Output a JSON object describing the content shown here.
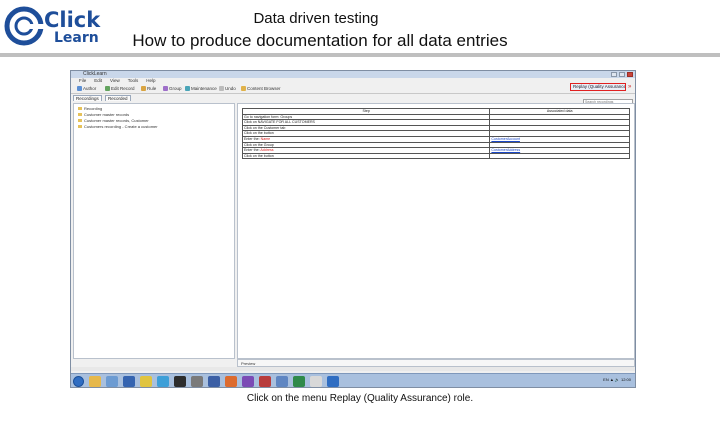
{
  "logo": {
    "line1": "Click",
    "line2": "Learn"
  },
  "slide": {
    "title": "Data driven testing",
    "subtitle": "How to produce documentation for all data entries",
    "caption": "Click on the menu Replay (Quality Assurance) role."
  },
  "app": {
    "window_title": "ClickLearn",
    "menu": [
      "File",
      "Edit",
      "View",
      "Tools",
      "Help"
    ],
    "toolbar": {
      "items": [
        {
          "label": "Author",
          "color": "#5b8fd4"
        },
        {
          "label": "Edit Record",
          "color": "#62a35e"
        },
        {
          "label": "Rule",
          "color": "#d9a441"
        },
        {
          "label": "Group",
          "color": "#9e6fc9"
        },
        {
          "label": "Maintenance",
          "color": "#4aa5b8"
        },
        {
          "label": "Undo",
          "color": "#bcbcbc"
        },
        {
          "label": "Content Browser",
          "color": "#e0b24a"
        }
      ],
      "role_button": "Replay (Quality Assurance) role",
      "role_extra": "»"
    },
    "tabs": [
      "Recordings",
      "Recorded"
    ],
    "search_placeholder": "Search recordings"
  },
  "tree": [
    "Recording",
    "Customer master records",
    "Customer master records, Customer",
    "Customers recording - Create a customer"
  ],
  "grid": {
    "headers": [
      "Step",
      "Associated data"
    ],
    "rows": [
      {
        "step": "Go to navigation form: Groups",
        "value": "",
        "red": false
      },
      {
        "step": "Click on NAVIGATE FOR ALL CUSTOMERS",
        "value": "",
        "red": false
      },
      {
        "step": "Click on the Customer tab",
        "value": "",
        "red": false
      },
      {
        "step": "Click on the button",
        "value": "",
        "red": false
      },
      {
        "step": "Enter the: Name",
        "value": "CustomerAccount",
        "red": true
      },
      {
        "step": "Click on the Group",
        "value": "",
        "red": false
      },
      {
        "step": "Enter the: Address",
        "value": "CustomerAddress",
        "red": true
      },
      {
        "step": "Click on the button",
        "value": "",
        "red": false
      }
    ]
  },
  "bottom": {
    "label": "Preview"
  },
  "taskbar": {
    "icons": [
      {
        "name": "explorer",
        "color": "#e6b84b"
      },
      {
        "name": "charts",
        "color": "#6c9bd2"
      },
      {
        "name": "word",
        "color": "#3564b0"
      },
      {
        "name": "chrome",
        "color": "#e0c440"
      },
      {
        "name": "browser",
        "color": "#3d9fd8"
      },
      {
        "name": "terminal",
        "color": "#2d2d2d"
      },
      {
        "name": "paint",
        "color": "#7a7a7a"
      },
      {
        "name": "office",
        "color": "#3b5fa5"
      },
      {
        "name": "firefox",
        "color": "#dc6b2f"
      },
      {
        "name": "visual-studio",
        "color": "#7b4bb5"
      },
      {
        "name": "onenote",
        "color": "#b83c3c"
      },
      {
        "name": "outlook",
        "color": "#5f86c2"
      },
      {
        "name": "excel",
        "color": "#2f8a4a"
      },
      {
        "name": "app",
        "color": "#d8d8d8"
      },
      {
        "name": "ie",
        "color": "#2f6dc2"
      }
    ],
    "tray": "EN  ▲ 🔈  12:00"
  }
}
